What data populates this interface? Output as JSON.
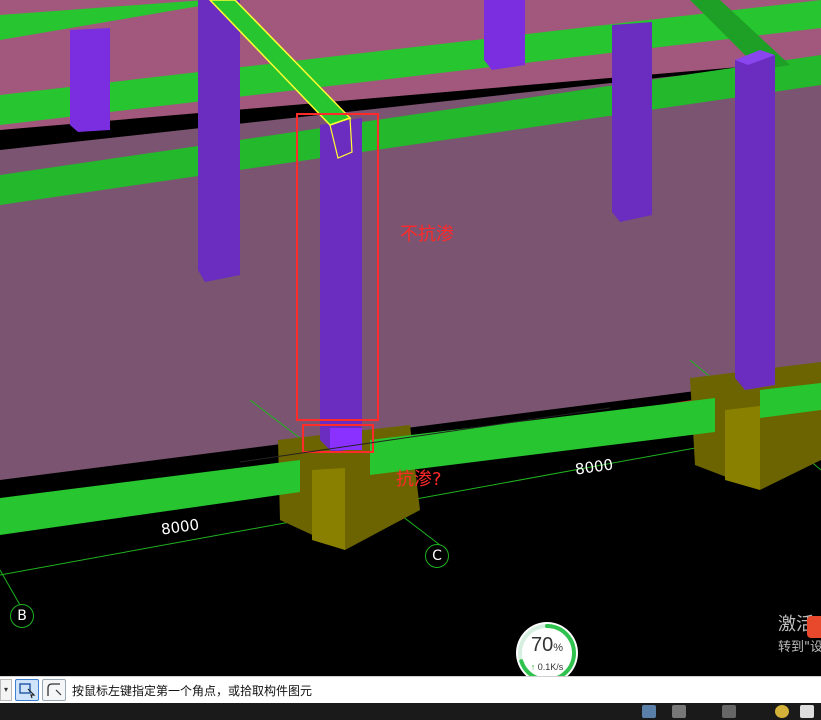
{
  "annotations": {
    "label_not_impermeable": "不抗渗",
    "label_impermeable_question": "抗渗?"
  },
  "dimensions": {
    "dim_left": "8000",
    "dim_right": "8000"
  },
  "axes": {
    "axis_b": "B",
    "axis_c": "C"
  },
  "watermark": {
    "line1": "激活",
    "line2": "转到\"设"
  },
  "performance": {
    "percent": "70",
    "percent_unit": "%",
    "speed": "0.1K/s",
    "level": 0.7
  },
  "statusbar": {
    "prompt": "按鼠标左键指定第一个角点，或拾取构件图元",
    "buttons": [
      "select-mode-icon",
      "polyline-pick-icon"
    ]
  },
  "colors": {
    "beam_green": "#27c52f",
    "column_purple": "#6b2cc0",
    "wall_pink": "#9a5878",
    "footing_olive": "#6b6400",
    "annotation_red": "#ff2a2a",
    "grid_green": "#1fb31f"
  }
}
